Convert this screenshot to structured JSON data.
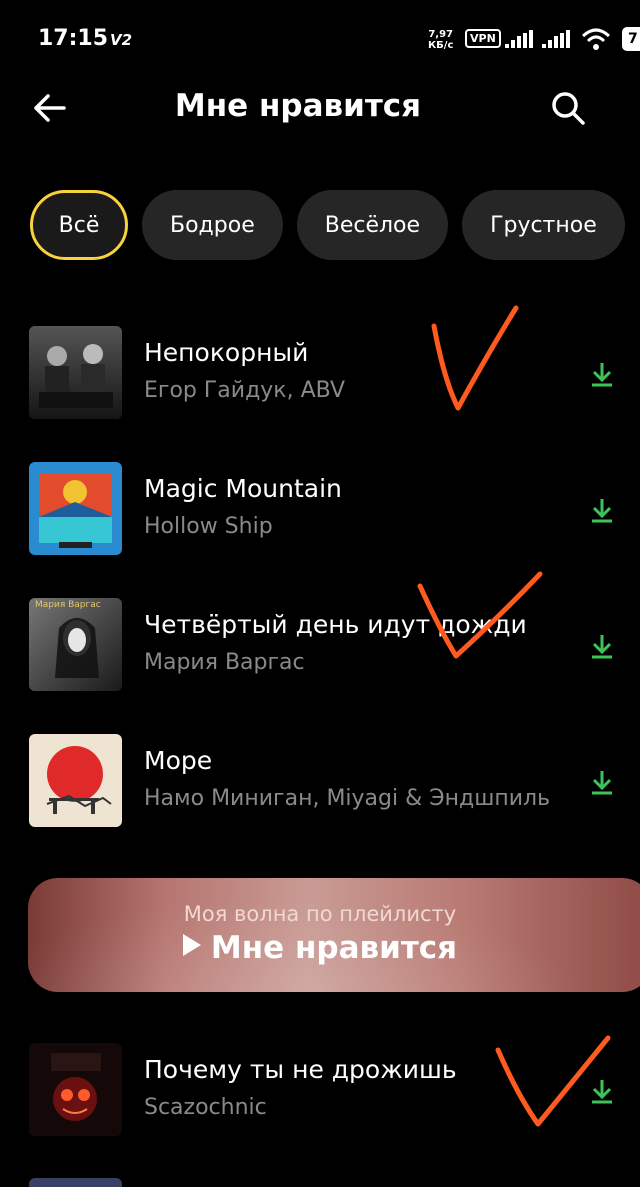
{
  "status_bar": {
    "time": "17:15",
    "network_label": "V2",
    "speed_value": "7,97",
    "speed_unit": "КБ/с",
    "vpn": "VPN",
    "battery": "7"
  },
  "header": {
    "title": "Мне нравится",
    "back_icon": "arrow-left-icon",
    "search_icon": "search-icon"
  },
  "filters": [
    {
      "label": "Всё",
      "active": true
    },
    {
      "label": "Бодрое",
      "active": false
    },
    {
      "label": "Весёлое",
      "active": false
    },
    {
      "label": "Грустное",
      "active": false
    }
  ],
  "tracks": [
    {
      "title": "Непокорный",
      "artist": "Егор Гайдук, ABV",
      "downloaded": true
    },
    {
      "title": "Magic Mountain",
      "artist": "Hollow Ship",
      "downloaded": true
    },
    {
      "title": "Четвёртый день идут дожди",
      "artist": "Мария Варгас",
      "cover_text": "Мария Варгас",
      "downloaded": true
    },
    {
      "title": "Море",
      "artist": "Намо Миниган, Miyagi & Эндшпиль",
      "downloaded": true
    },
    {
      "title": "Почему ты не дрожишь",
      "artist": "Scazochnic",
      "downloaded": true
    }
  ],
  "wave_banner": {
    "subtitle": "Моя волна по плейлисту",
    "title": "Мне нравится"
  },
  "colors": {
    "accent_chip_border": "#f7d23c",
    "download_green": "#3bc45a",
    "annotation_orange": "#ff5a1f",
    "background": "#000000"
  }
}
